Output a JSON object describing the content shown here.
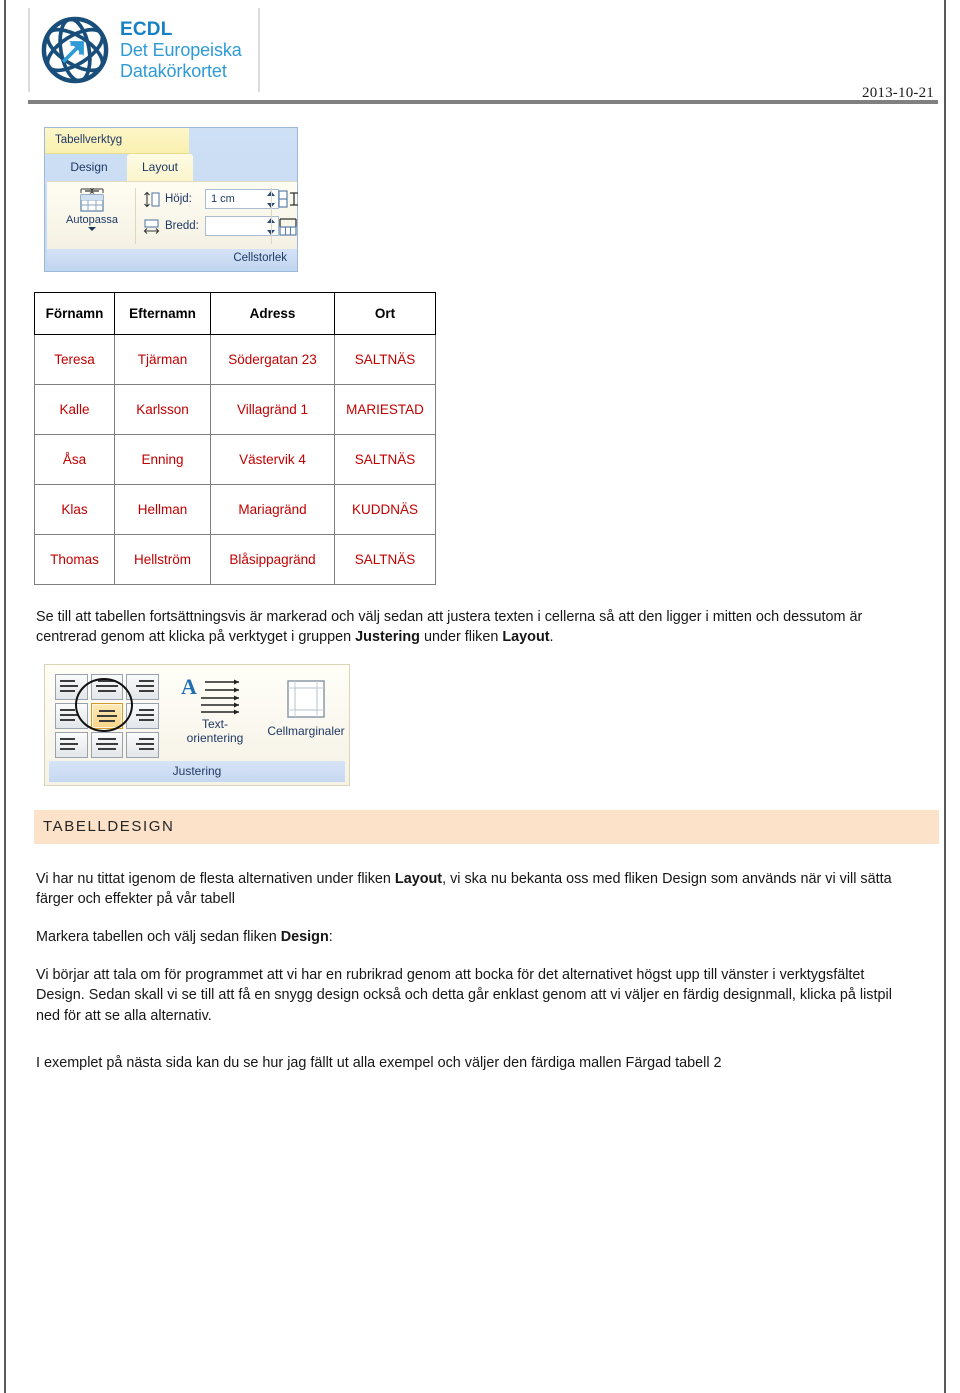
{
  "header": {
    "logo": {
      "icon": "ecdl-globe-arrow-logo",
      "line1": "ECDL",
      "line2": "Det Europeiska",
      "line3": "Datakörkortet",
      "brand_color": "#1581c4",
      "secondary_color": "#2e9bd6"
    },
    "date": "2013-10-21"
  },
  "ribbon_layout": {
    "context_title": "Tabellverktyg",
    "tabs": [
      {
        "label": "Design",
        "selected": false
      },
      {
        "label": "Layout",
        "selected": true
      }
    ],
    "autofit_button": {
      "label": "Autopassa",
      "icon": "autofit-table-icon"
    },
    "fields": [
      {
        "label": "Höjd:",
        "value": "1 cm",
        "icon": "row-height-icon"
      },
      {
        "label": "Bredd:",
        "value": "",
        "icon": "column-width-icon"
      }
    ],
    "distribute_rows_icon": "distribute-rows-icon",
    "distribute_cols_icon": "distribute-columns-icon",
    "group_label": "Cellstorlek"
  },
  "table": {
    "headers": [
      "Förnamn",
      "Efternamn",
      "Adress",
      "Ort"
    ],
    "header_color": "#000000",
    "cell_color": "#c00000",
    "rows": [
      [
        "Teresa",
        "Tjärman",
        "Södergatan 23",
        "SALTNÄS"
      ],
      [
        "Kalle",
        "Karlsson",
        "Villagränd 1",
        "MARIESTAD"
      ],
      [
        "Åsa",
        "Enning",
        "Västervik 4",
        "SALTNÄS"
      ],
      [
        "Klas",
        "Hellman",
        "Mariagränd",
        "KUDDNÄS"
      ],
      [
        "Thomas",
        "Hellström",
        "Blåsippagränd",
        "SALTNÄS"
      ]
    ]
  },
  "paragraph_after_table": {
    "part1": "Se till att tabellen fortsättningsvis är markerad och välj sedan att justera texten i cellerna så att den ligger i mitten och dessutom är centrerad genom att klicka på verktyget i gruppen ",
    "bold1": "Justering",
    "part2": " under fliken ",
    "bold2": "Layout",
    "part3": "."
  },
  "ribbon_justering": {
    "alignment_grid_name": "alignment-grid",
    "selected_cell_index": 4,
    "text_orientation_button": {
      "label_line1": "Text-",
      "label_line2": "orientering",
      "icon": "text-direction-icon"
    },
    "cell_margins_button": {
      "label": "Cellmarginaler",
      "icon": "cell-margins-icon"
    },
    "group_label": "Justering",
    "annotation": "ellipse-highlight-center-align"
  },
  "section": {
    "title": "TABELLDESIGN",
    "band_color": "#fbe2c9"
  },
  "body": {
    "p1_part1": "Vi har nu tittat igenom de flesta alternativen under fliken ",
    "p1_bold": "Layout",
    "p1_part2": ", vi ska nu bekanta oss med fliken Design som används när vi vill sätta färger och effekter på vår tabell",
    "p2_part1": "Markera tabellen och välj sedan fliken ",
    "p2_bold": "Design",
    "p2_part2": ":",
    "p3": "Vi börjar att tala om för programmet att vi har en rubrikrad genom att bocka för det alternativet högst upp till vänster i verktygsfältet Design. Sedan skall vi se till att få en snygg design också och detta går enklast genom att vi väljer en färdig designmall, klicka på listpil ned för att se alla alternativ.",
    "p4": "I exemplet på nästa sida kan du se hur jag fällt ut alla exempel och väljer den färdiga mallen Färgad tabell 2"
  }
}
